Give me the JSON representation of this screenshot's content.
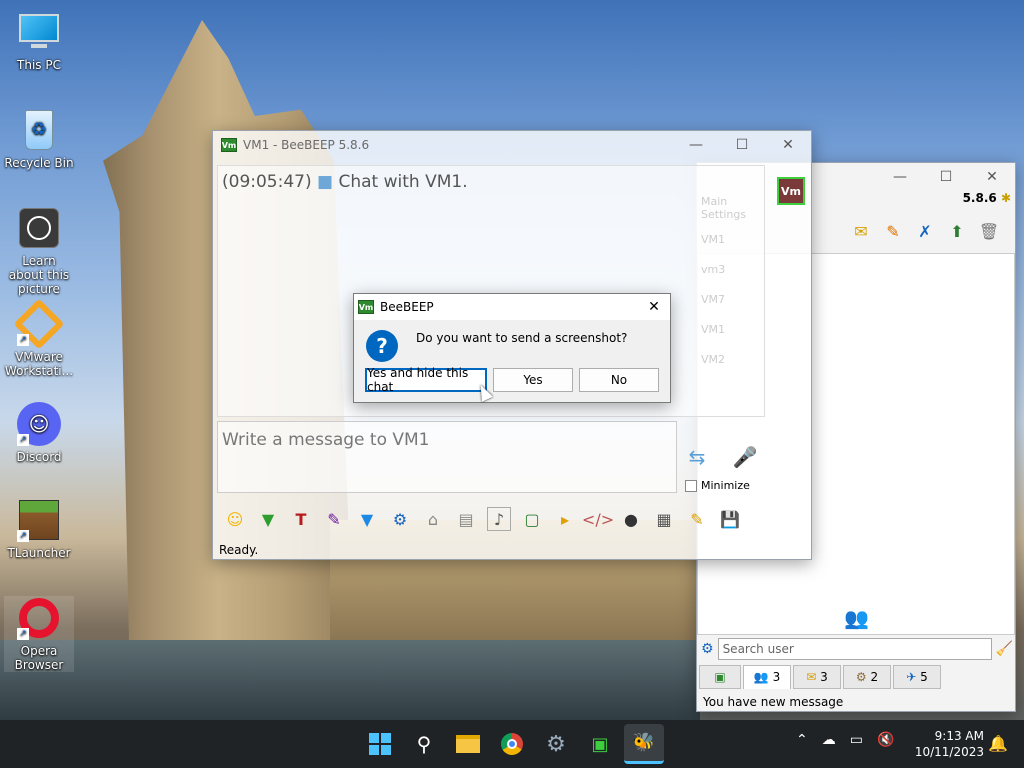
{
  "desktop": {
    "icons": [
      {
        "label": "This PC",
        "icon": "monitor-icon"
      },
      {
        "label": "Recycle Bin",
        "icon": "recycle-bin-icon"
      },
      {
        "label": "Learn about this picture",
        "icon": "camera-icon"
      },
      {
        "label": "VMware Workstati...",
        "icon": "vmware-icon"
      },
      {
        "label": "Discord",
        "icon": "discord-icon"
      },
      {
        "label": "TLauncher",
        "icon": "minecraft-icon"
      },
      {
        "label": "Opera Browser",
        "icon": "opera-icon"
      }
    ]
  },
  "main_window": {
    "title": "VM1 - BeeBEEP 5.8.6",
    "badge": "Vm",
    "version": "5.8.6",
    "menu": [
      "Main",
      "Settings"
    ],
    "users": [
      "VM1",
      "vm3",
      "VM7",
      "VM1",
      "VM2"
    ],
    "search_placeholder": "Search user",
    "tabs": [
      {
        "icon": "chat-tab-icon",
        "count": ""
      },
      {
        "icon": "users-icon",
        "count": "3"
      },
      {
        "icon": "groups-icon",
        "count": "3"
      },
      {
        "icon": "network-icon",
        "count": "2"
      },
      {
        "icon": "plugin-icon",
        "count": "5"
      }
    ],
    "status": "You have new message"
  },
  "chat_window": {
    "title": "VM1 - BeeBEEP 5.8.6",
    "chat_time": "(09:05:47)",
    "chat_text": "Chat with VM1.",
    "message_placeholder": "Write a message to VM1",
    "minimize_label": "Minimize",
    "status": "Ready."
  },
  "dialog": {
    "title": "BeeBEEP",
    "question": "Do you want to send a screenshot?",
    "btn_yes_hide": "Yes and hide this chat",
    "btn_yes": "Yes",
    "btn_no": "No"
  },
  "taskbar": {
    "time": "9:13 AM",
    "date": "10/11/2023"
  },
  "colors": {
    "accent": "#0067c0",
    "badge_green": "#2f8a2f",
    "taskbar": "#1f2326"
  }
}
